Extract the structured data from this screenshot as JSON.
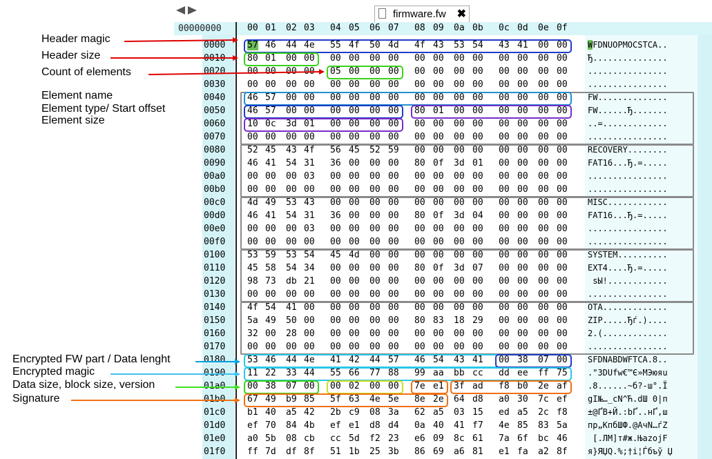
{
  "tab": {
    "title": "firmware.fw",
    "close": "✖"
  },
  "first_col_header": "00000000",
  "col_headers": [
    "00",
    "01",
    "02",
    "03",
    "04",
    "05",
    "06",
    "07",
    "08",
    "09",
    "0a",
    "0b",
    "0c",
    "0d",
    "0e",
    "0f"
  ],
  "rows": [
    {
      "off": "0000",
      "bytes": [
        "57",
        "46",
        "44",
        "4e",
        "55",
        "4f",
        "50",
        "4d",
        "4f",
        "43",
        "53",
        "54",
        "43",
        "41",
        "00",
        "00"
      ],
      "ascii": "WFDNUOPMOCSTCA.."
    },
    {
      "off": "0010",
      "bytes": [
        "80",
        "01",
        "00",
        "00",
        "00",
        "00",
        "00",
        "00",
        "00",
        "00",
        "00",
        "00",
        "00",
        "00",
        "00",
        "00"
      ],
      "ascii": "Ђ..............."
    },
    {
      "off": "0020",
      "bytes": [
        "00",
        "00",
        "00",
        "00",
        "05",
        "00",
        "00",
        "00",
        "00",
        "00",
        "00",
        "00",
        "00",
        "00",
        "00",
        "00"
      ],
      "ascii": "................"
    },
    {
      "off": "0030",
      "bytes": [
        "00",
        "00",
        "00",
        "00",
        "00",
        "00",
        "00",
        "00",
        "00",
        "00",
        "00",
        "00",
        "00",
        "00",
        "00",
        "00"
      ],
      "ascii": "................"
    },
    {
      "off": "0040",
      "bytes": [
        "46",
        "57",
        "00",
        "00",
        "00",
        "00",
        "00",
        "00",
        "00",
        "00",
        "00",
        "00",
        "00",
        "00",
        "00",
        "00"
      ],
      "ascii": "FW.............."
    },
    {
      "off": "0050",
      "bytes": [
        "46",
        "57",
        "00",
        "00",
        "00",
        "00",
        "00",
        "00",
        "80",
        "01",
        "00",
        "00",
        "00",
        "00",
        "00",
        "00"
      ],
      "ascii": "FW......Ђ......."
    },
    {
      "off": "0060",
      "bytes": [
        "10",
        "0c",
        "3d",
        "01",
        "00",
        "00",
        "00",
        "00",
        "00",
        "00",
        "00",
        "00",
        "00",
        "00",
        "00",
        "00"
      ],
      "ascii": "..=............."
    },
    {
      "off": "0070",
      "bytes": [
        "00",
        "00",
        "00",
        "00",
        "00",
        "00",
        "00",
        "00",
        "00",
        "00",
        "00",
        "00",
        "00",
        "00",
        "00",
        "00"
      ],
      "ascii": "................"
    },
    {
      "off": "0080",
      "bytes": [
        "52",
        "45",
        "43",
        "4f",
        "56",
        "45",
        "52",
        "59",
        "00",
        "00",
        "00",
        "00",
        "00",
        "00",
        "00",
        "00"
      ],
      "ascii": "RECOVERY........"
    },
    {
      "off": "0090",
      "bytes": [
        "46",
        "41",
        "54",
        "31",
        "36",
        "00",
        "00",
        "00",
        "80",
        "0f",
        "3d",
        "01",
        "00",
        "00",
        "00",
        "00"
      ],
      "ascii": "FAT16...Ђ.=....."
    },
    {
      "off": "00a0",
      "bytes": [
        "00",
        "00",
        "00",
        "03",
        "00",
        "00",
        "00",
        "00",
        "00",
        "00",
        "00",
        "00",
        "00",
        "00",
        "00",
        "00"
      ],
      "ascii": "................"
    },
    {
      "off": "00b0",
      "bytes": [
        "00",
        "00",
        "00",
        "00",
        "00",
        "00",
        "00",
        "00",
        "00",
        "00",
        "00",
        "00",
        "00",
        "00",
        "00",
        "00"
      ],
      "ascii": "................"
    },
    {
      "off": "00c0",
      "bytes": [
        "4d",
        "49",
        "53",
        "43",
        "00",
        "00",
        "00",
        "00",
        "00",
        "00",
        "00",
        "00",
        "00",
        "00",
        "00",
        "00"
      ],
      "ascii": "MISC............"
    },
    {
      "off": "00d0",
      "bytes": [
        "46",
        "41",
        "54",
        "31",
        "36",
        "00",
        "00",
        "00",
        "80",
        "0f",
        "3d",
        "04",
        "00",
        "00",
        "00",
        "00"
      ],
      "ascii": "FAT16...Ђ.=....."
    },
    {
      "off": "00e0",
      "bytes": [
        "00",
        "00",
        "00",
        "03",
        "00",
        "00",
        "00",
        "00",
        "00",
        "00",
        "00",
        "00",
        "00",
        "00",
        "00",
        "00"
      ],
      "ascii": "................"
    },
    {
      "off": "00f0",
      "bytes": [
        "00",
        "00",
        "00",
        "00",
        "00",
        "00",
        "00",
        "00",
        "00",
        "00",
        "00",
        "00",
        "00",
        "00",
        "00",
        "00"
      ],
      "ascii": "................"
    },
    {
      "off": "0100",
      "bytes": [
        "53",
        "59",
        "53",
        "54",
        "45",
        "4d",
        "00",
        "00",
        "00",
        "00",
        "00",
        "00",
        "00",
        "00",
        "00",
        "00"
      ],
      "ascii": "SYSTEM.........."
    },
    {
      "off": "0110",
      "bytes": [
        "45",
        "58",
        "54",
        "34",
        "00",
        "00",
        "00",
        "00",
        "80",
        "0f",
        "3d",
        "07",
        "00",
        "00",
        "00",
        "00"
      ],
      "ascii": "EXT4....Ђ.=....."
    },
    {
      "off": "0120",
      "bytes": [
        "98",
        "73",
        "db",
        "21",
        "00",
        "00",
        "00",
        "00",
        "00",
        "00",
        "00",
        "00",
        "00",
        "00",
        "00",
        "00"
      ],
      "ascii": " sЫ!............"
    },
    {
      "off": "0130",
      "bytes": [
        "00",
        "00",
        "00",
        "00",
        "00",
        "00",
        "00",
        "00",
        "00",
        "00",
        "00",
        "00",
        "00",
        "00",
        "00",
        "00"
      ],
      "ascii": "................"
    },
    {
      "off": "0140",
      "bytes": [
        "4f",
        "54",
        "41",
        "00",
        "00",
        "00",
        "00",
        "00",
        "00",
        "00",
        "00",
        "00",
        "00",
        "00",
        "00",
        "00"
      ],
      "ascii": "OTA............."
    },
    {
      "off": "0150",
      "bytes": [
        "5a",
        "49",
        "50",
        "00",
        "00",
        "00",
        "00",
        "00",
        "80",
        "83",
        "18",
        "29",
        "00",
        "00",
        "00",
        "00"
      ],
      "ascii": "ZIP.....Ђѓ.)...."
    },
    {
      "off": "0160",
      "bytes": [
        "32",
        "00",
        "28",
        "00",
        "00",
        "00",
        "00",
        "00",
        "00",
        "00",
        "00",
        "00",
        "00",
        "00",
        "00",
        "00"
      ],
      "ascii": "2.(............."
    },
    {
      "off": "0170",
      "bytes": [
        "00",
        "00",
        "00",
        "00",
        "00",
        "00",
        "00",
        "00",
        "00",
        "00",
        "00",
        "00",
        "00",
        "00",
        "00",
        "00"
      ],
      "ascii": "................"
    },
    {
      "off": "0180",
      "bytes": [
        "53",
        "46",
        "44",
        "4e",
        "41",
        "42",
        "44",
        "57",
        "46",
        "54",
        "43",
        "41",
        "00",
        "38",
        "07",
        "00"
      ],
      "ascii": "SFDNABDWFTCA.8.."
    },
    {
      "off": "0190",
      "bytes": [
        "11",
        "22",
        "33",
        "44",
        "55",
        "66",
        "77",
        "88",
        "99",
        "aa",
        "bb",
        "cc",
        "dd",
        "ee",
        "ff",
        "75"
      ],
      "ascii": ".\"3DUfw€™Є»МЭюяu"
    },
    {
      "off": "01a0",
      "bytes": [
        "00",
        "38",
        "07",
        "00",
        "00",
        "02",
        "00",
        "00",
        "7e",
        "e1",
        "3f",
        "ad",
        "f8",
        "b0",
        "2e",
        "af"
      ],
      "ascii": ".8......~б?-ш°.Ї"
    },
    {
      "off": "01b0",
      "bytes": [
        "67",
        "49",
        "b9",
        "85",
        "5f",
        "63",
        "4e",
        "5e",
        "8e",
        "2e",
        "64",
        "d8",
        "a0",
        "30",
        "7c",
        "ef"
      ],
      "ascii": "gI№…_cN^Ћ.dШ 0|п"
    },
    {
      "off": "01c0",
      "bytes": [
        "b1",
        "40",
        "a5",
        "42",
        "2b",
        "c9",
        "08",
        "3a",
        "62",
        "a5",
        "03",
        "15",
        "ed",
        "a5",
        "2c",
        "f8"
      ],
      "ascii": "±@ҐB+Й.:bҐ..нҐ,ш"
    },
    {
      "off": "01d0",
      "bytes": [
        "ef",
        "70",
        "84",
        "4b",
        "ef",
        "e1",
        "d8",
        "d4",
        "0a",
        "40",
        "41",
        "f7",
        "4e",
        "85",
        "83",
        "5a"
      ],
      "ascii": "пр„KпбШФ.@AчN…ѓZ"
    },
    {
      "off": "01e0",
      "bytes": [
        "a0",
        "5b",
        "08",
        "cb",
        "cc",
        "5d",
        "f2",
        "23",
        "e6",
        "09",
        "8c",
        "61",
        "7a",
        "6f",
        "bc",
        "46"
      ],
      "ascii": " [.ЛМ]т#ж.ЊazojF"
    },
    {
      "off": "01f0",
      "bytes": [
        "ff",
        "7d",
        "df",
        "8f",
        "51",
        "1b",
        "25",
        "3b",
        "86",
        "69",
        "a6",
        "81",
        "e1",
        "fa",
        "a2",
        "8f"
      ],
      "ascii": "я}ЯЏQ.%;†i¦Ѓбъў Џ"
    }
  ],
  "annotations": [
    {
      "text": "Header magic",
      "color": "#e00000"
    },
    {
      "text": "Header size",
      "color": "#e00000"
    },
    {
      "text": "Count of elements",
      "color": "#e00000"
    },
    {
      "text": "Element name",
      "color": "#000000"
    },
    {
      "text": "Element type/ Start offset",
      "color": "#000000"
    },
    {
      "text": "Element size",
      "color": "#000000"
    },
    {
      "text": "Encrypted FW part / Data lenght",
      "color": "#00a0e0"
    },
    {
      "text": "Encrypted magic",
      "color": "#40c0f0"
    },
    {
      "text": "Data size, block size, version",
      "color": "#40e020"
    },
    {
      "text": "Signature",
      "color": "#f07010"
    }
  ],
  "colors": {
    "blue": "#1f3cc8",
    "green": "#38d21a",
    "yellow": "#c8e020",
    "gray": "#8a8a8a",
    "purple": "#7a2ccc",
    "cyan": "#28c8e8",
    "orange": "#f07010",
    "red": "#e00000",
    "highlight": "#6bbd57"
  }
}
